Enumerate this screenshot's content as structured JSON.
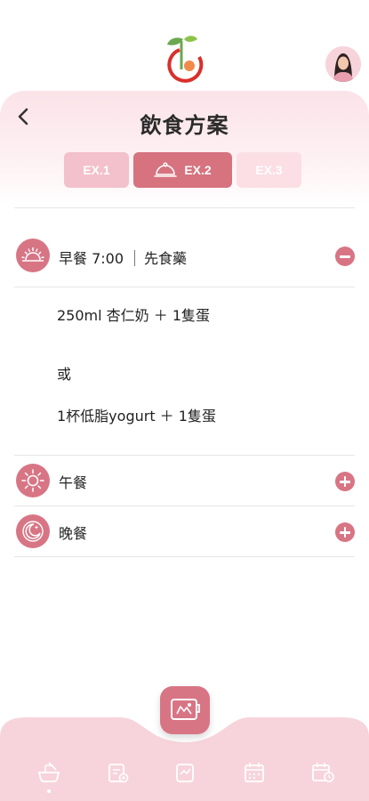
{
  "header": {
    "title": "飲食方案"
  },
  "tabs": [
    {
      "label": "EX.1",
      "active": false
    },
    {
      "label": "EX.2",
      "active": true
    },
    {
      "label": "EX.3",
      "active": false
    }
  ],
  "meals": {
    "breakfast": {
      "label": "早餐 7:00",
      "note": "先食藥",
      "expanded": true,
      "icon": "sunrise-icon"
    },
    "lunch": {
      "label": "午餐",
      "expanded": false,
      "icon": "sun-icon"
    },
    "dinner": {
      "label": "晚餐",
      "expanded": false,
      "icon": "moon-icon"
    }
  },
  "breakfast_options": {
    "option1": "250ml 杏仁奶 ＋ 1隻蛋",
    "separator": "或",
    "option2": "1杯低脂yogurt ＋ 1隻蛋"
  },
  "colors": {
    "accent": "#d87585",
    "tab_light": "#f3c1cb",
    "header_bg": "#fbe3e8",
    "nav_bg": "#f7d4db"
  },
  "bottom_nav": {
    "items": [
      {
        "icon": "meal-plan-icon",
        "active": true
      },
      {
        "icon": "record-icon",
        "active": false
      },
      {
        "icon": "report-icon",
        "active": false
      },
      {
        "icon": "calendar-icon",
        "active": false
      },
      {
        "icon": "schedule-icon",
        "active": false
      }
    ],
    "center_icon": "tv-icon"
  }
}
